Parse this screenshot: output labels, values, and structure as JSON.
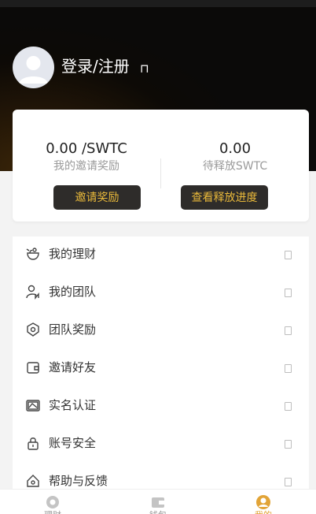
{
  "profile": {
    "login_label": "登录/注册",
    "login_arrow": "⊓"
  },
  "stats": {
    "invite_reward_value": "0.00 /SWTC",
    "invite_reward_label": "我的邀请奖励",
    "pending_release_value": "0.00",
    "pending_release_label": "待释放SWTC",
    "invite_button": "邀请奖励",
    "progress_button": "查看释放进度"
  },
  "menu": {
    "items": [
      {
        "label": "我的理财",
        "icon": "wealth-icon"
      },
      {
        "label": "我的团队",
        "icon": "team-icon"
      },
      {
        "label": "团队奖励",
        "icon": "reward-icon"
      },
      {
        "label": "邀请好友",
        "icon": "wallet-icon"
      },
      {
        "label": "实名认证",
        "icon": "id-card-icon"
      },
      {
        "label": "账号安全",
        "icon": "lock-icon"
      },
      {
        "label": "帮助与反馈",
        "icon": "help-icon"
      }
    ]
  },
  "tabbar": {
    "tabs": [
      {
        "label": "理财",
        "icon": "finance-icon",
        "active": false
      },
      {
        "label": "钱包",
        "icon": "wallet-tab-icon",
        "active": false
      },
      {
        "label": "我的",
        "icon": "profile-icon",
        "active": true
      }
    ]
  },
  "colors": {
    "accent": "#e9b93a",
    "active_tab": "#e2a437",
    "button_bg": "#2e2c2a"
  }
}
